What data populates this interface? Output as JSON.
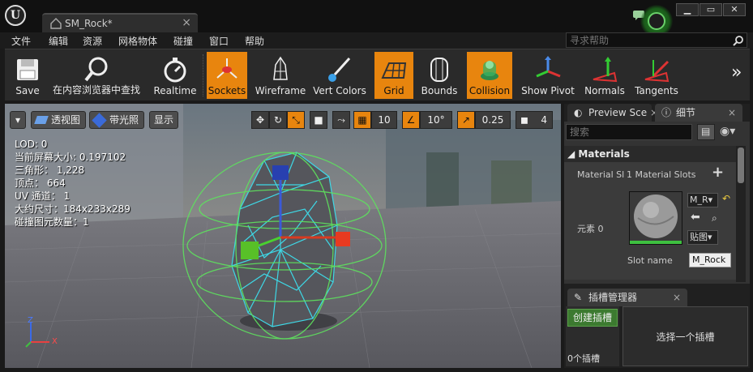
{
  "window": {
    "app_logo": "U",
    "tab_title": "SM_Rock*",
    "tab_close": "×",
    "controls": {
      "minimize": "▁",
      "maximize": "▭",
      "close": "✕"
    }
  },
  "menu": {
    "items": [
      "文件",
      "编辑",
      "资源",
      "网格物体",
      "碰撞",
      "窗口",
      "帮助"
    ],
    "search_placeholder": "寻求帮助"
  },
  "toolbar": {
    "buttons": [
      {
        "label": "Save",
        "icon": "save-icon",
        "active": false
      },
      {
        "label": "在内容浏览器中查找",
        "icon": "magnifier-icon",
        "active": false
      },
      {
        "label": "Realtime",
        "icon": "stopwatch-icon",
        "active": false
      },
      {
        "label": "Sockets",
        "icon": "sockets-icon",
        "active": true
      },
      {
        "label": "Wireframe",
        "icon": "wireframe-icon",
        "active": false
      },
      {
        "label": "Vert Colors",
        "icon": "vert-colors-icon",
        "active": false
      },
      {
        "label": "Grid",
        "icon": "grid-icon",
        "active": true
      },
      {
        "label": "Bounds",
        "icon": "bounds-icon",
        "active": false
      },
      {
        "label": "Collision",
        "icon": "collision-icon",
        "active": true
      },
      {
        "label": "Show Pivot",
        "icon": "pivot-icon",
        "active": false
      },
      {
        "label": "Normals",
        "icon": "normals-icon",
        "active": false
      },
      {
        "label": "Tangents",
        "icon": "tangents-icon",
        "active": false
      }
    ],
    "overflow": "»",
    "active_color": "#e8850e"
  },
  "viewport": {
    "perspective_label": "透视图",
    "lit_label": "带光照",
    "show_label": "显示",
    "grid_snap_value": "10",
    "rotation_snap_value": "10°",
    "scale_snap_value": "0.25",
    "camera_speed_value": "4",
    "stats": [
      "LOD:  0",
      "当前屏幕大小:  0.197102",
      "三角形：  1,228",
      "顶点：  664",
      "UV 通道：  1",
      "大约尺寸：184x233x289",
      "碰撞图元数量：1"
    ],
    "axis_x": "X",
    "axis_z": "Z",
    "collision_color": "#3ed8e6",
    "bounds_color": "#5ee25e"
  },
  "right_panel": {
    "tabs": [
      {
        "label": "Preview Sce",
        "close": "×"
      },
      {
        "label": "细节",
        "close": "×"
      }
    ],
    "search_placeholder": "搜索",
    "category": "Materials",
    "material_slots_label": "Material Sl",
    "material_slots_value": "1 Material Slots",
    "add_symbol": "+",
    "element_label": "元素 0",
    "material_name_short": "M_R",
    "texture_label": "贴图",
    "slot_name_label": "Slot name",
    "slot_name_value": "M_Rock"
  },
  "socket_manager": {
    "title": "插槽管理器",
    "create_label": "创建插槽",
    "count_label": "0个插槽",
    "select_prompt": "选择一个插槽",
    "close": "×"
  }
}
